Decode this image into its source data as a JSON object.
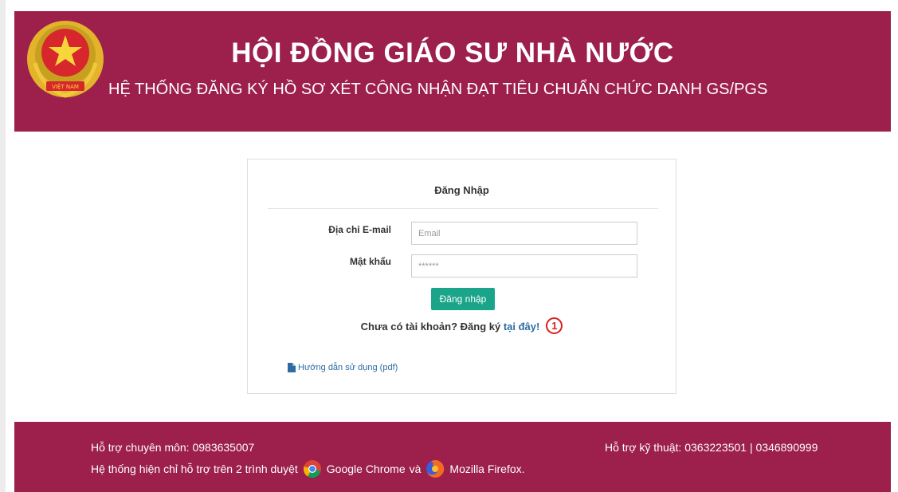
{
  "header": {
    "title": "HỘI ĐỒNG GIÁO SƯ NHÀ NƯỚC",
    "subtitle": "HỆ THỐNG ĐĂNG KÝ HỒ SƠ XÉT CÔNG NHẬN ĐẠT TIÊU CHUẨN CHỨC DANH GS/PGS",
    "emblem_text": "VIỆT NAM",
    "emblem_icon": "national-emblem-icon"
  },
  "login": {
    "title": "Đăng Nhập",
    "email_label": "Địa chỉ E-mail",
    "email_placeholder": "Email",
    "email_value": "",
    "password_label": "Mật khẩu",
    "password_placeholder": "******",
    "password_value": "",
    "submit_label": "Đăng nhập",
    "register_prompt": "Chưa có tài khoản? Đăng ký ",
    "register_link": "tại đây!",
    "annotation_marker": "1",
    "guide_link": "Hướng dẫn sử dụng (pdf)",
    "guide_icon": "file-icon"
  },
  "footer": {
    "support_content": "Hỗ trợ chuyên môn: 0983635007",
    "support_technical": "Hỗ trợ kỹ thuật: 0363223501 | 0346890999",
    "browser_note_prefix": "Hệ thống hiện chỉ hỗ trợ trên 2 trình duyệt",
    "browser_chrome": "Google Chrome",
    "browser_and": "và",
    "browser_firefox": "Mozilla Firefox.",
    "chrome_icon": "chrome-icon",
    "firefox_icon": "firefox-icon"
  },
  "colors": {
    "brand": "#9c1f4c",
    "button": "#1aa489",
    "link": "#2d6ca2",
    "marker": "#d61f1f"
  }
}
